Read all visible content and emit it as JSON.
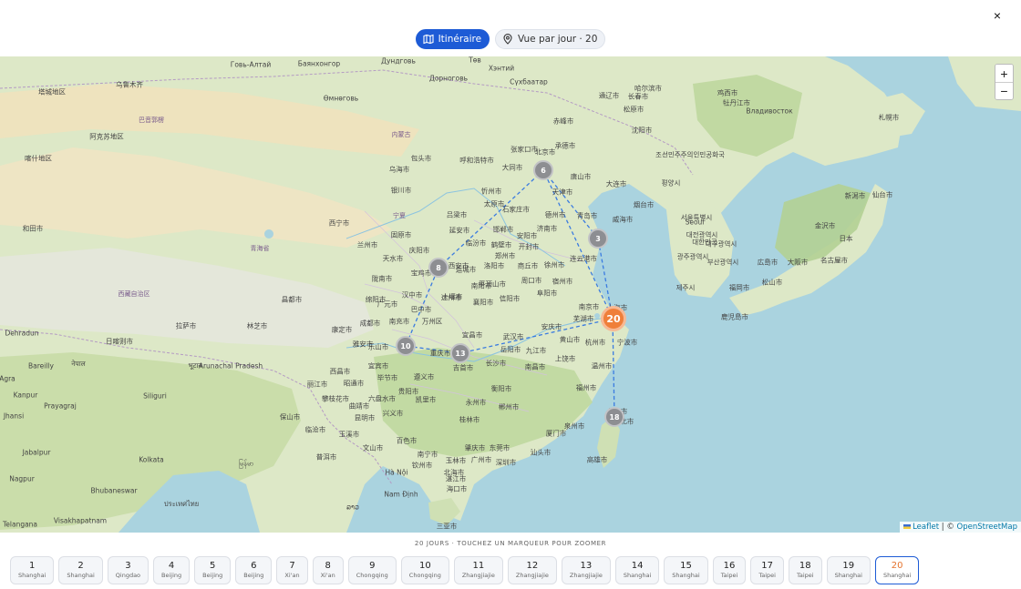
{
  "close_label": "×",
  "toolbar": {
    "itinerary_label": "Itinéraire",
    "day_view_label": "Vue par jour · 20"
  },
  "map": {
    "zoom_in": "+",
    "zoom_out": "−",
    "attribution": {
      "leaflet": "Leaflet",
      "separator": " | © ",
      "osm": "OpenStreetMap"
    },
    "markers": [
      {
        "label": "6",
        "style": "gray"
      },
      {
        "label": "3",
        "style": "gray"
      },
      {
        "label": "8",
        "style": "gray"
      },
      {
        "label": "20",
        "style": "orange"
      },
      {
        "label": "10",
        "style": "gray"
      },
      {
        "label": "13",
        "style": "gray"
      },
      {
        "label": "18",
        "style": "gray"
      }
    ],
    "place_labels": [
      "北京市",
      "天津市",
      "张家口市",
      "承德市",
      "赤峰市",
      "沈阳市",
      "大连市",
      "唐山市",
      "呼和浩特市",
      "包头市",
      "乌海市",
      "大同市",
      "忻州市",
      "石家庄市",
      "太原市",
      "德州市",
      "济南市",
      "烟台市",
      "威海市",
      "青岛市",
      "邯郸市",
      "鹤壁市",
      "郑州市",
      "开封市",
      "徐州市",
      "连云港市",
      "宿州市",
      "南京市",
      "芜湖市",
      "上海市",
      "杭州市",
      "宁波市",
      "安庆市",
      "武汉市",
      "黄山市",
      "九江市",
      "南昌市",
      "上饶市",
      "温州市",
      "福州市",
      "泉州市",
      "厦门市",
      "汕头市",
      "广州市",
      "深圳市",
      "东莞市",
      "肇庆市",
      "玉林市",
      "北海市",
      "海口市",
      "三亚市",
      "桂林市",
      "永州市",
      "郴州市",
      "衡阳市",
      "长沙市",
      "岳阳市",
      "吉首市",
      "宜昌市",
      "重庆市",
      "万州区",
      "达州市",
      "南充市",
      "巴中市",
      "成都市",
      "乐山市",
      "宜宾市",
      "毕节市",
      "遵义市",
      "贵阳市",
      "凯里市",
      "六盘水市",
      "昭通市",
      "昆明市",
      "曲靖市",
      "玉溪市",
      "普洱市",
      "文山市",
      "百色市",
      "兴义市",
      "南宁市",
      "钦州市",
      "湛江市",
      "临沧市",
      "保山市",
      "丽江市",
      "攀枝花市",
      "西昌市",
      "汉中市",
      "十堰市",
      "襄阳市",
      "信阳市",
      "周口市",
      "阜阳市",
      "商丘市",
      "安阳市",
      "运城市",
      "延安市",
      "吕梁市",
      "临汾市",
      "宝鸡市",
      "天水市",
      "兰州市",
      "西宁市",
      "固原市",
      "银川市",
      "庆阳市",
      "陇南市",
      "广元市",
      "绵阳市",
      "雅安市",
      "康定市",
      "西安市",
      "洛阳市",
      "平顶山市",
      "南阳市",
      "高雄市",
      "台北市",
      "新北市",
      "Seoul",
      "서울특별시",
      "부산광역시",
      "대구광역시",
      "대전광역시",
      "광주광역시",
      "제주시",
      "평양시",
      "조선민주주의인민공화국",
      "대한민국",
      "福岡市",
      "広島市",
      "大阪市",
      "名古屋市",
      "松山市",
      "鹿児島市",
      "金沢市",
      "新潟市",
      "仙台市",
      "札幌市",
      "日本",
      "Владивосток",
      "哈尔滨市",
      "长春市",
      "牡丹江市",
      "鸡西市",
      "通辽市",
      "松原市",
      "乌鲁木齐",
      "塔城地区",
      "阿克苏地区",
      "和田市",
      "喀什地区",
      "巴音郭楞",
      "青海省",
      "西藏自治区",
      "拉萨市",
      "日喀则市",
      "林芝市",
      "昌都市",
      "Arunachal Pradesh",
      "Dehradun",
      "Bareilly",
      "Agra",
      "Kanpur",
      "Prayagraj",
      "Siliguri",
      "Jabalpur",
      "Kolkata",
      "Bhubaneswar",
      "Visakhapatnam",
      "Telangana",
      "Hà Nội",
      "Nam Định",
      "Jhansi",
      "Nagpur",
      "नेपाल",
      "भूटान",
      "မြန်မာ",
      "ລາວ",
      "ประเทศไทย",
      "Говь-Алтай",
      "Баянхонгор",
      "Өмнөговь",
      "Дорноговь",
      "Дундговь",
      "Хэнтий",
      "Сүхбаатар",
      "Төв",
      "宁夏",
      "内蒙古",
      "天水市",
      "西安市"
    ]
  },
  "hint": "20 JOURS · TOUCHEZ UN MARQUEUR POUR ZOOMER",
  "days": [
    {
      "num": "1",
      "city": "Shanghai"
    },
    {
      "num": "2",
      "city": "Shanghai"
    },
    {
      "num": "3",
      "city": "Qingdao"
    },
    {
      "num": "4",
      "city": "Beijing"
    },
    {
      "num": "5",
      "city": "Beijing"
    },
    {
      "num": "6",
      "city": "Beijing"
    },
    {
      "num": "7",
      "city": "Xi'an"
    },
    {
      "num": "8",
      "city": "Xi'an"
    },
    {
      "num": "9",
      "city": "Chongqing"
    },
    {
      "num": "10",
      "city": "Chongqing"
    },
    {
      "num": "11",
      "city": "Zhangjiajie"
    },
    {
      "num": "12",
      "city": "Zhangjiajie"
    },
    {
      "num": "13",
      "city": "Zhangjiajie"
    },
    {
      "num": "14",
      "city": "Shanghai"
    },
    {
      "num": "15",
      "city": "Shanghai"
    },
    {
      "num": "16",
      "city": "Taipei"
    },
    {
      "num": "17",
      "city": "Taipei"
    },
    {
      "num": "18",
      "city": "Taipei"
    },
    {
      "num": "19",
      "city": "Shanghai"
    },
    {
      "num": "20",
      "city": "Shanghai"
    }
  ],
  "selected_day": "20",
  "colors": {
    "accent": "#1d5bd6",
    "marker_selected": "#ef7f3a",
    "marker_default": "#8d8e92",
    "route": "#3a7be0"
  }
}
